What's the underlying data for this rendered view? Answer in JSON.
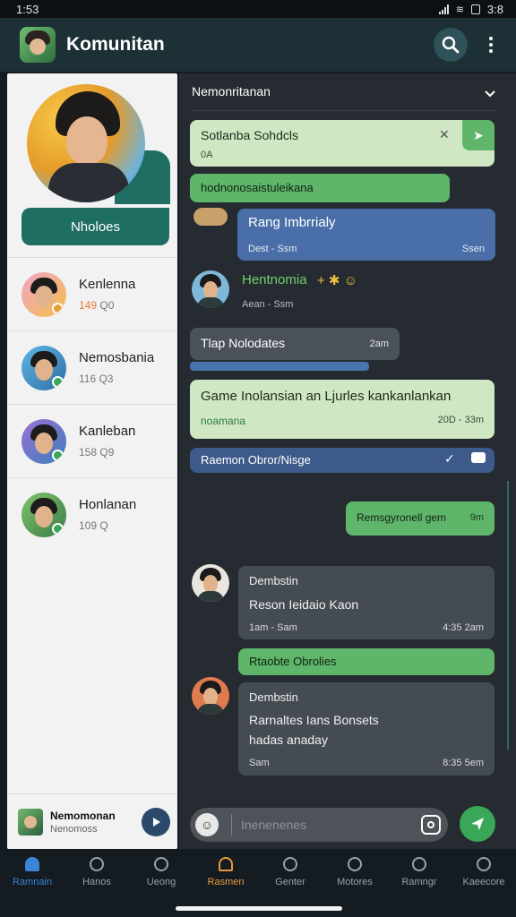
{
  "status_bar": {
    "time": "1:53",
    "right_time": "3:8"
  },
  "app_bar": {
    "title": "Komunitan"
  },
  "profile": {
    "name": "Nholoes"
  },
  "contacts": [
    {
      "name": "Kenlenna",
      "meta_hot": "149",
      "meta": "Q0"
    },
    {
      "name": "Nemosbania",
      "meta_hot": "",
      "meta": "116 Q3"
    },
    {
      "name": "Kanleban",
      "meta_hot": "",
      "meta": "158 Q9"
    },
    {
      "name": "Honlanan",
      "meta_hot": "",
      "meta": "109 Q"
    }
  ],
  "left_footer": {
    "name": "Nemomonan",
    "sub": "Nenomoss"
  },
  "chat": {
    "title": "Nemonritanan",
    "messages": {
      "m1": {
        "text": "Sotlanba Sohdcls",
        "meta": "0A"
      },
      "m2": {
        "text": "hodnonosaistuleikana"
      },
      "m3": {
        "text": "Rang Imbrrialy",
        "meta_left": "Dest - Ssm",
        "meta_right": "Ssen"
      },
      "m4": {
        "name": "Hentnomia",
        "meta": "Aean - Ssm"
      },
      "m5": {
        "text": "Tlap Nolodates",
        "meta": "2am"
      },
      "m6": {
        "text": "Game Inolansian an Ljurles kankanlankan",
        "sub": "noamana",
        "meta": "20D - 33m"
      },
      "m7": {
        "text": "Raemon Obror/Nisge"
      },
      "m8": {
        "text": "Remsgyronell gem",
        "meta": "9m"
      },
      "m9": {
        "name": "Dembstin",
        "text": "Reson Ieidaio Kaon",
        "meta_left": "1am - Sam",
        "meta_right": "4:35 2am"
      },
      "m10": {
        "text": "Rtaobte Obrolies"
      },
      "m11": {
        "name": "Dembstin",
        "text": "Rarnaltes Ians Bonsets",
        "text2": "hadas anaday",
        "meta_left": "Sam",
        "meta_right": "8:35 5em"
      }
    },
    "input": {
      "placeholder": "Inenenenes"
    }
  },
  "bottom_nav": [
    "Ramnain",
    "Hanos",
    "Ueong",
    "Rasmen",
    "Genter",
    "Motores",
    "Ramngr",
    "Kaeecore"
  ]
}
